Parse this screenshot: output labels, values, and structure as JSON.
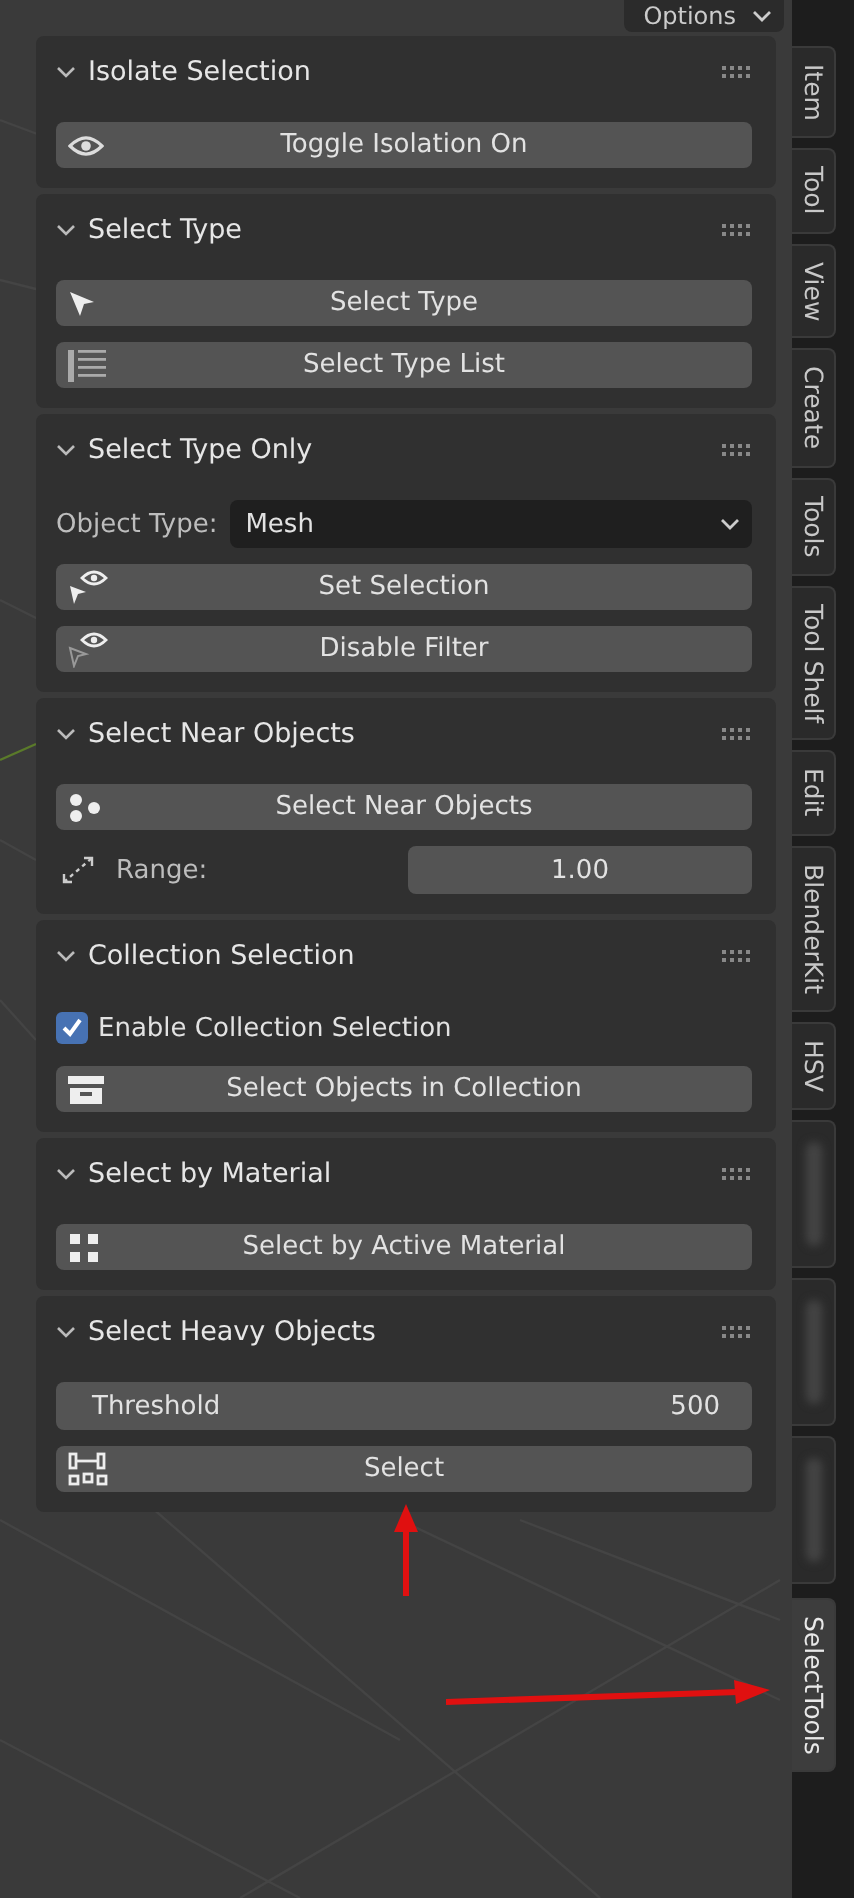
{
  "options": {
    "label": "Options"
  },
  "panels": [
    {
      "title": "Isolate Selection",
      "expanded": true,
      "rows": [
        {
          "kind": "button",
          "label": "Toggle Isolation On"
        }
      ]
    },
    {
      "title": "Select Type",
      "expanded": true,
      "rows": [
        {
          "kind": "button",
          "label": "Select Type"
        },
        {
          "kind": "button",
          "label": "Select Type List"
        }
      ]
    },
    {
      "title": "Select Type Only",
      "expanded": true,
      "rows": [
        {
          "kind": "dropdown",
          "label": "Object Type:",
          "value": "Mesh"
        },
        {
          "kind": "button",
          "label": "Set Selection"
        },
        {
          "kind": "button",
          "label": "Disable Filter"
        }
      ]
    },
    {
      "title": "Select Near Objects",
      "expanded": true,
      "rows": [
        {
          "kind": "button",
          "label": "Select Near Objects"
        },
        {
          "kind": "field",
          "label": "Range:",
          "value": "1.00"
        }
      ]
    },
    {
      "title": "Collection Selection",
      "expanded": true,
      "rows": [
        {
          "kind": "checkbox",
          "label": "Enable Collection Selection",
          "checked": true
        },
        {
          "kind": "button",
          "label": "Select Objects in Collection"
        }
      ]
    },
    {
      "title": "Select by Material",
      "expanded": true,
      "rows": [
        {
          "kind": "button",
          "label": "Select by Active Material"
        }
      ]
    },
    {
      "title": "Select Heavy Objects",
      "expanded": true,
      "rows": [
        {
          "kind": "number",
          "label": "Threshold",
          "value": "500"
        },
        {
          "kind": "button",
          "label": "Select"
        }
      ]
    }
  ],
  "tabs": [
    {
      "kind": "text",
      "label": "Item",
      "selected": false
    },
    {
      "kind": "text",
      "label": "Tool",
      "selected": false
    },
    {
      "kind": "text",
      "label": "View",
      "selected": false
    },
    {
      "kind": "text",
      "label": "Create",
      "selected": false
    },
    {
      "kind": "text",
      "label": "Tools",
      "selected": false
    },
    {
      "kind": "text",
      "label": "Tool Shelf",
      "selected": false
    },
    {
      "kind": "text",
      "label": "Edit",
      "selected": false
    },
    {
      "kind": "text",
      "label": "BlenderKit",
      "selected": false
    },
    {
      "kind": "text",
      "label": "HSV",
      "selected": false
    },
    {
      "kind": "blurred",
      "selected": false
    },
    {
      "kind": "blurred",
      "selected": false
    },
    {
      "kind": "blurred",
      "selected": false
    },
    {
      "kind": "text",
      "label": "SelectTools",
      "selected": true
    }
  ]
}
